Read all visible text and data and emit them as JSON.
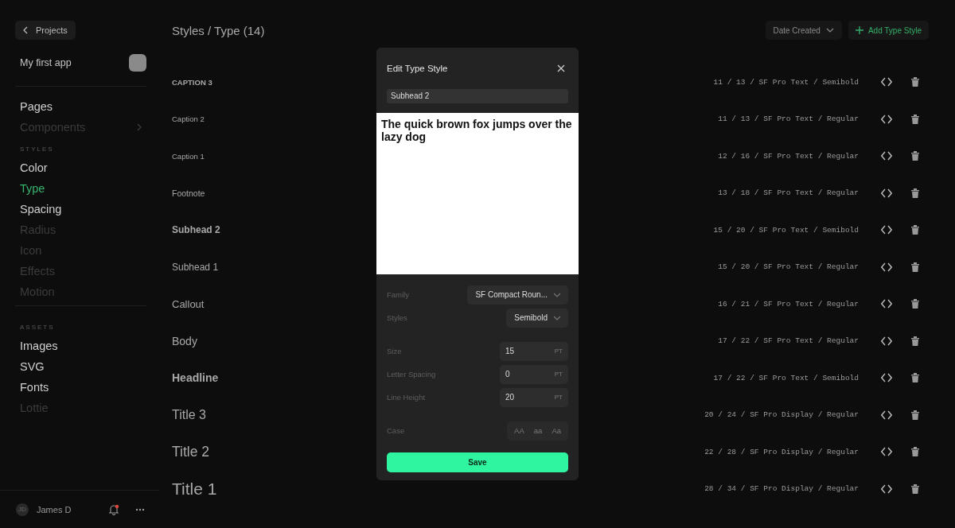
{
  "sidebar": {
    "back_button": "Projects",
    "project": {
      "name": "My first app"
    },
    "nav": [
      {
        "label": "Pages",
        "selected": false,
        "disabled": false,
        "expandable": false
      },
      {
        "label": "Components",
        "selected": false,
        "disabled": true,
        "expandable": true
      }
    ],
    "sections": [
      {
        "title": "STYLES",
        "items": [
          {
            "label": "Color",
            "selected": false,
            "disabled": false
          },
          {
            "label": "Type",
            "selected": true,
            "disabled": false
          },
          {
            "label": "Spacing",
            "selected": false,
            "disabled": false
          },
          {
            "label": "Radius",
            "selected": false,
            "disabled": true
          },
          {
            "label": "Icon",
            "selected": false,
            "disabled": true
          },
          {
            "label": "Effects",
            "selected": false,
            "disabled": true
          },
          {
            "label": "Motion",
            "selected": false,
            "disabled": true
          }
        ]
      },
      {
        "title": "ASSETS",
        "items": [
          {
            "label": "Images",
            "selected": false,
            "disabled": false
          },
          {
            "label": "SVG",
            "selected": false,
            "disabled": false
          },
          {
            "label": "Fonts",
            "selected": false,
            "disabled": false
          },
          {
            "label": "Lottie",
            "selected": false,
            "disabled": true
          }
        ]
      }
    ],
    "user": {
      "initials": "JD",
      "name": "James D",
      "unread": true
    }
  },
  "header": {
    "title": "Styles / Type (14)",
    "sort": "Date Created",
    "add_button": "Add Type Style"
  },
  "styles": [
    {
      "kind": "caption3",
      "name": "CAPTION 3",
      "spec": "11 / 13 / SF Pro Text / Semibold"
    },
    {
      "kind": "caption2",
      "name": "Caption 2",
      "spec": "11 / 13 / SF Pro Text / Regular"
    },
    {
      "kind": "caption1",
      "name": "Caption 1",
      "spec": "12 / 16 / SF Pro Text / Regular"
    },
    {
      "kind": "footnote",
      "name": "Footnote",
      "spec": "13 / 18 / SF Pro Text / Regular"
    },
    {
      "kind": "subhead2",
      "name": "Subhead 2",
      "spec": "15 / 20 / SF Pro Text / Semibold"
    },
    {
      "kind": "subhead1",
      "name": "Subhead 1",
      "spec": "15 / 20 / SF Pro Text / Regular"
    },
    {
      "kind": "callout",
      "name": "Callout",
      "spec": "16 / 21 / SF Pro Text / Regular"
    },
    {
      "kind": "body",
      "name": "Body",
      "spec": "17 / 22 / SF Pro Text / Regular"
    },
    {
      "kind": "headline",
      "name": "Headline",
      "spec": "17 / 22 / SF Pro Text / Semibold"
    },
    {
      "kind": "title3",
      "name": "Title 3",
      "spec": "20 / 24 / SF Pro Display / Regular"
    },
    {
      "kind": "title2",
      "name": "Title 2",
      "spec": "22 / 28 / SF Pro Display / Regular"
    },
    {
      "kind": "title1",
      "name": "Title 1",
      "spec": "28 / 34 / SF Pro Display / Regular"
    }
  ],
  "dialog": {
    "title": "Edit Type Style",
    "name_value": "Subhead 2",
    "preview": "The quick brown fox jumps over the lazy dog",
    "family": {
      "label": "Family",
      "value": "SF Compact Roun..."
    },
    "style": {
      "label": "Styles",
      "value": "Semibold"
    },
    "metrics": [
      {
        "label": "Size",
        "value": "15",
        "unit": "PT"
      },
      {
        "label": "Letter Spacing",
        "value": "0",
        "unit": "PT"
      },
      {
        "label": "Line Height",
        "value": "20",
        "unit": "PT"
      }
    ],
    "case": {
      "label": "Case",
      "options": [
        {
          "label": "AA",
          "selected": false
        },
        {
          "label": "aa",
          "selected": false
        },
        {
          "label": "Aa",
          "selected": false
        }
      ]
    },
    "save": "Save"
  }
}
